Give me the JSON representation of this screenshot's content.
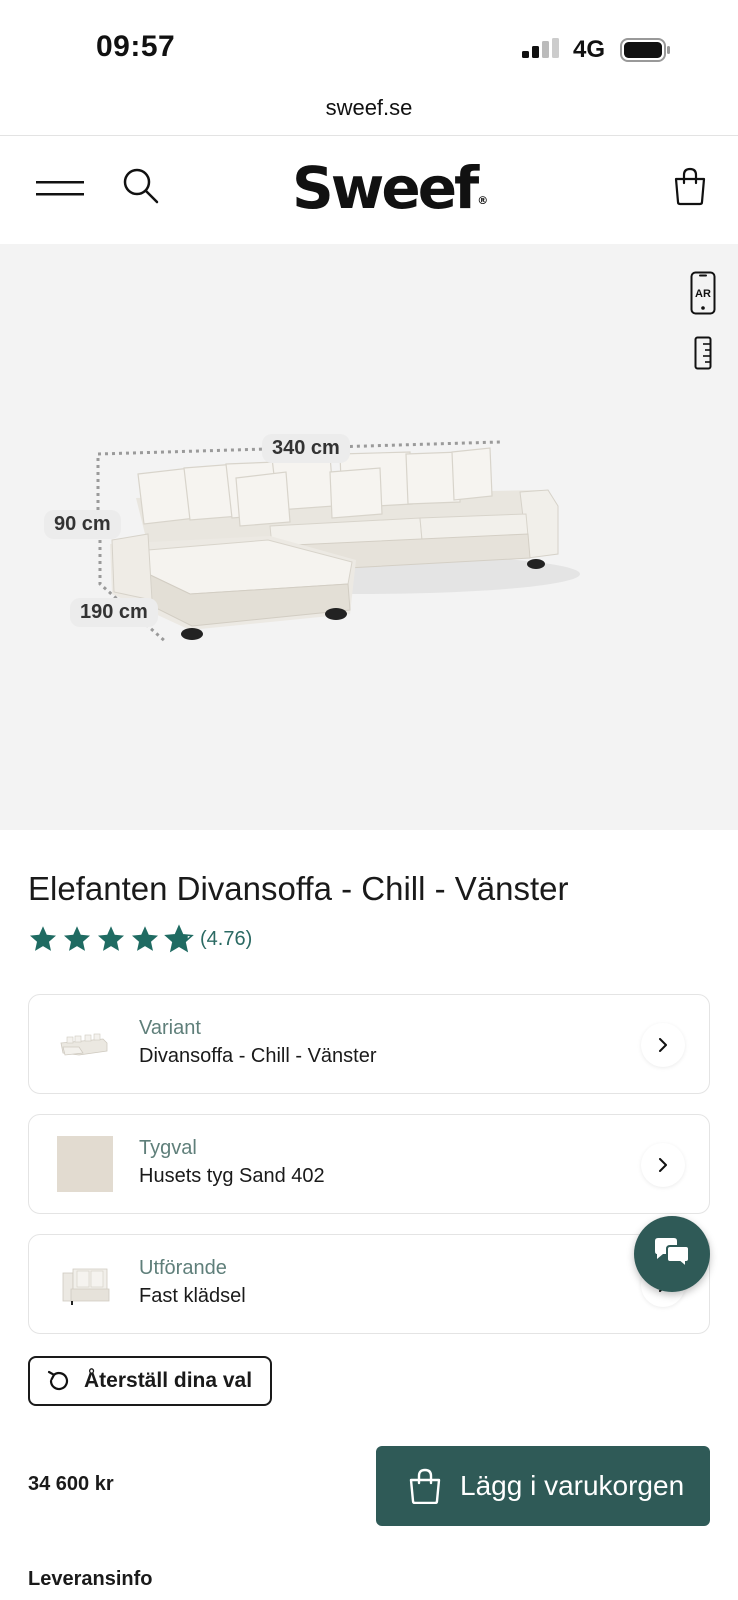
{
  "status_bar": {
    "time": "09:57",
    "network": "4G"
  },
  "browser": {
    "url": "sweef.se"
  },
  "header": {
    "logo": "Sweef",
    "logo_mark": "®"
  },
  "product_view": {
    "ar_label": "AR",
    "dimensions": {
      "width": "340 cm",
      "height": "90 cm",
      "depth": "190 cm"
    }
  },
  "product": {
    "title": "Elefanten Divansoffa - Chill - Vänster",
    "rating": {
      "value_text": "(4.76)",
      "value": 4.76,
      "max": 5
    }
  },
  "options": [
    {
      "label": "Variant",
      "value": "Divansoffa - Chill - Vänster",
      "thumb": "sofa-thumbnail"
    },
    {
      "label": "Tygval",
      "value": "Husets tyg Sand 402",
      "thumb": "fabric-swatch"
    },
    {
      "label": "Utförande",
      "value": "Fast klädsel",
      "thumb": "upholstery-thumbnail"
    }
  ],
  "actions": {
    "reset_label": "Återställ dina val",
    "price": "34 600 kr",
    "add_to_cart_label": "Lägg i varukorgen"
  },
  "footer": {
    "delivery_heading": "Leveransinfo"
  },
  "colors": {
    "accent": "#2f5a57",
    "star": "#1f6b62",
    "stage_bg": "#f3f3f3",
    "swatch": "#e2dbd0"
  }
}
